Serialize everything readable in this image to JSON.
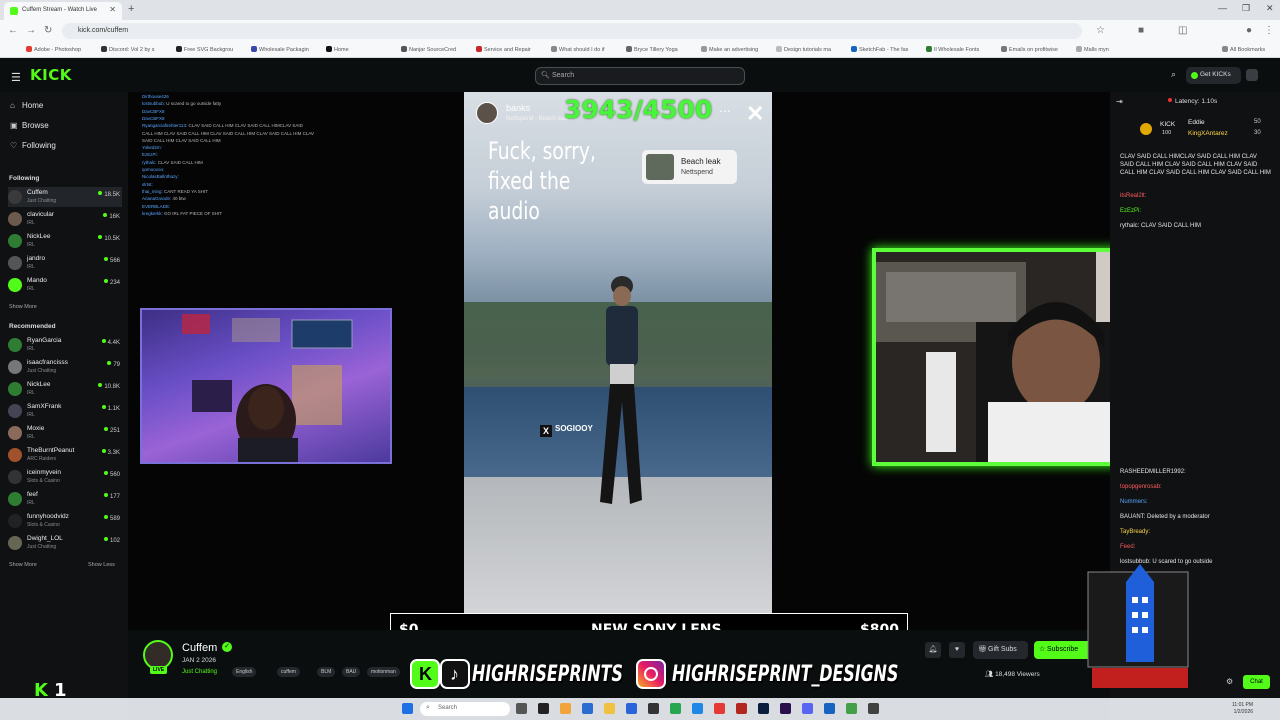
{
  "browser": {
    "tab_title": "Cuffem Stream - Watch Live",
    "url": "kick.com/cuffem",
    "bookmarks": [
      "Adobe - Photoshop",
      "Discord: Vol 2 by s",
      "Free SVG Backgrou",
      "Wholesale Packagin",
      "Home",
      "Nanjar SourceCred",
      "Service and Repair",
      "What should I do if",
      "Bryce Tillery Yoga",
      "Make an advertising",
      "Design tutorials ma",
      "SketchFab - The fas",
      "Il Wholesale Fonts",
      "Emails on profitwise",
      "Malls myn",
      "All Bookmarks"
    ]
  },
  "kick": {
    "logo": "KICK",
    "search_placeholder": "Search",
    "get_kicks": "Get KICKs"
  },
  "sidebar": {
    "nav": [
      {
        "label": "Home",
        "icon": "home-icon"
      },
      {
        "label": "Browse",
        "icon": "browse-icon"
      },
      {
        "label": "Following",
        "icon": "heart-icon"
      }
    ],
    "following_title": "Following",
    "following": [
      {
        "name": "Cuffem",
        "category": "Just Chatting",
        "viewers": "18.5K",
        "color": "#3a3a3a"
      },
      {
        "name": "clavicular",
        "category": "IRL",
        "viewers": "16K",
        "color": "#6b5a4d"
      },
      {
        "name": "NickLee",
        "category": "IRL",
        "viewers": "10.5K",
        "color": "#2e7d32"
      },
      {
        "name": "jandro",
        "category": "IRL",
        "viewers": "566",
        "color": "#555"
      },
      {
        "name": "Mando",
        "category": "IRL",
        "viewers": "234",
        "color": "#53fc18"
      }
    ],
    "show_more": "Show More",
    "recommended_title": "Recommended",
    "recommended": [
      {
        "name": "RyanGarcia",
        "category": "IRL",
        "viewers": "4.4K",
        "color": "#2e7d32"
      },
      {
        "name": "isaacfrancisss",
        "category": "Just Chatting",
        "viewers": "79",
        "color": "#777"
      },
      {
        "name": "NickLee",
        "category": "IRL",
        "viewers": "10.8K",
        "color": "#2e7d32"
      },
      {
        "name": "SamXFrank",
        "category": "IRL",
        "viewers": "1.1K",
        "color": "#445"
      },
      {
        "name": "Moxie",
        "category": "IRL",
        "viewers": "251",
        "color": "#8a6a5a"
      },
      {
        "name": "TheBurntPeanut",
        "category": "ARC Raiders",
        "viewers": "3.3K",
        "color": "#a0522d"
      },
      {
        "name": "iceinmyvein",
        "category": "Slots & Casino",
        "viewers": "560",
        "color": "#333"
      },
      {
        "name": "feef",
        "category": "IRL",
        "viewers": "177",
        "color": "#2e7d32"
      },
      {
        "name": "funnyhoodvidz",
        "category": "Slots & Casino",
        "viewers": "589",
        "color": "#222"
      },
      {
        "name": "Dwight_LOL",
        "category": "Just Chatting",
        "viewers": "102",
        "color": "#665"
      }
    ],
    "show_more_2": "Show More",
    "show_less": "Show Less"
  },
  "video": {
    "overlay_chat": [
      {
        "user": "Dirthouse426",
        "msg": ""
      },
      {
        "user": "lostsubbub:",
        "msg": "U scared to go outside fatty"
      },
      {
        "user": "DavCBFX8",
        "msg": ""
      },
      {
        "user": "DavCBFX8",
        "msg": ""
      },
      {
        "user": "Ryangarciafirehter113:",
        "msg": "CLAV SAID CALL HIM CLAV SAID CALL HIMCLAV SAID"
      },
      {
        "user": "",
        "msg": "CALL HIM CLAV SAID CALL HIM CLAV SAID CALL HIM CLAV SAID CALL HIM CLAV"
      },
      {
        "user": "",
        "msg": "SAID CALL HIM CLAV SAID CALL HIM"
      },
      {
        "user": "Yoked2m:",
        "msg": ""
      },
      {
        "user": "EzEzPi:",
        "msg": ""
      },
      {
        "user": "rythalc:",
        "msg": "CLAV SAID CALL HIM"
      },
      {
        "user": "qomoovoo:",
        "msg": ""
      },
      {
        "user": "NicolasBallnthazy:",
        "msg": ""
      },
      {
        "user": "slrtst:",
        "msg": ""
      },
      {
        "user": "thai_ming:",
        "msg": "CANT READ YA SHIT"
      },
      {
        "user": "ArianaGrande:",
        "msg": "40 btw"
      },
      {
        "user": "EVERBLADE:",
        "msg": ""
      },
      {
        "user": "kregkerkk:",
        "msg": "GO IRL FAT PIECE OF SHIT"
      }
    ],
    "phone": {
      "username": "banks",
      "sub": "Nettspend - Beach leak",
      "counter": "3943/4500",
      "caption": "Fuck, sorry, fixed the audio",
      "song_title": "Beach leak",
      "song_artist": "Nettspend",
      "watermark": "SOGIOOY"
    },
    "money_bar": {
      "left": "$0",
      "center": "NEW SONY LENS",
      "right": "$800"
    }
  },
  "chat": {
    "latency": "Latency: 1.10s",
    "leaderboard": [
      {
        "name": "Eddie",
        "value": "50"
      },
      {
        "name": "KingXAntarez",
        "value": "30"
      }
    ],
    "kick_label": "KICK",
    "kick_value": "100",
    "messages_top": [
      {
        "user": "",
        "text": "CLAV SAID CALL HIMCLAV SAID CALL HIM CLAV SAID CALL HIM CLAV SAID CALL HIM CLAV SAID CALL HIM CLAV SAID CALL HIM CLAV SAID CALL HIM",
        "color": "#e6e6e6"
      },
      {
        "user": "itsReal2lt:",
        "text": "",
        "color": "#ff5c5c"
      },
      {
        "user": "EzEzPi:",
        "text": "",
        "color": "#53fc18"
      },
      {
        "user": "rythalc:",
        "text": "CLAV SAID CALL HIM",
        "color": "#e6e6e6"
      }
    ],
    "messages_bottom": [
      {
        "user": "RASHEEDMILLER1992:",
        "text": "",
        "color": "#e6e6e6"
      },
      {
        "user": "topopgenrosab:",
        "text": "",
        "color": "#ff5c5c"
      },
      {
        "user": "Nummers:",
        "text": "",
        "color": "#5aa6ff"
      },
      {
        "user": "BAUANT:",
        "text": "Deleted by a moderator",
        "color": "#e6e6e6"
      },
      {
        "user": "TayBready:",
        "text": "",
        "color": "#ffd54a"
      },
      {
        "user": "Feed:",
        "text": "",
        "color": "#ff5c5c"
      },
      {
        "user": "lostsubbub:",
        "text": "U scared to go outside",
        "color": "#e6e6e6"
      }
    ],
    "chat_button": "Chat"
  },
  "stream": {
    "name": "Cuffem",
    "live": "LIVE",
    "date": "JAN 2 2026",
    "category": "Just Chatting",
    "tags": [
      "English",
      "cuffem",
      "BLM",
      "BAU",
      "motionman",
      "BANG"
    ],
    "viewers": "18,498 Viewers",
    "gift_subs": "Gift Subs",
    "subscribe": "Subscribe"
  },
  "banner": {
    "handle1": "HIGHRISEPRINTS",
    "handle2": "HIGHRISEPRINT_DESIGNS",
    "logo_text": "HIGH RISE PRINTS & DESIGNS"
  },
  "taskbar": {
    "search": "Search",
    "time": "11:01 PM",
    "date": "1/2/2026"
  },
  "kick_counter": {
    "label": "K",
    "value": "1"
  }
}
